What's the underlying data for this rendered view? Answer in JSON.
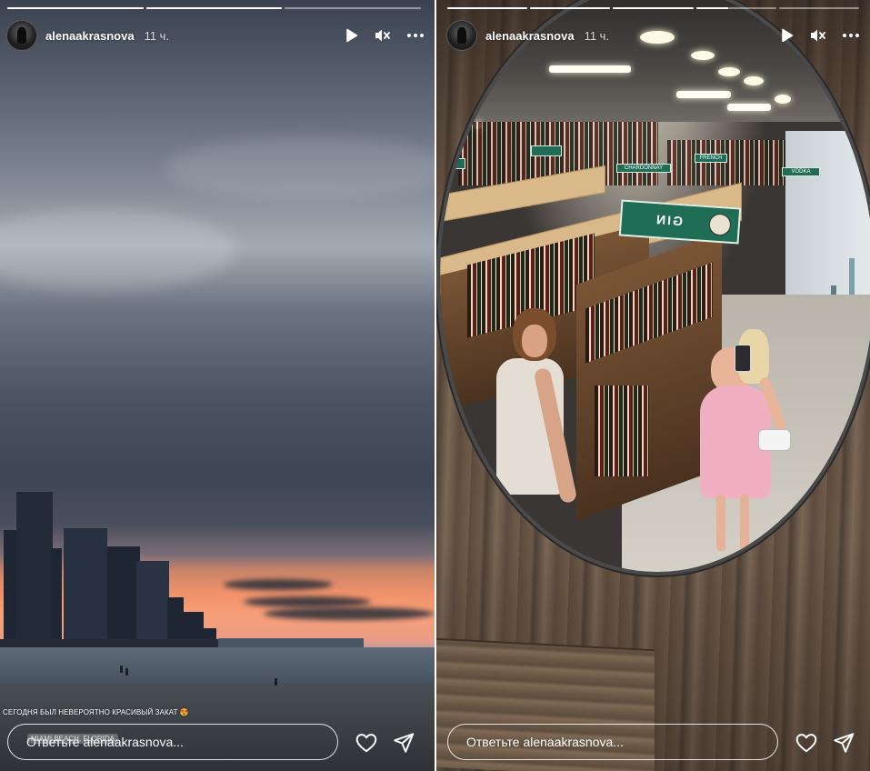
{
  "colors": {
    "overlay_text": "#ffffff",
    "progress_track": "rgba(255,255,255,0.45)",
    "progress_fill": "#ffffff",
    "gin_sign": "#1f6d55"
  },
  "stories": [
    {
      "progress": [
        1.0,
        1.0,
        0.0
      ],
      "username": "alenaakrasnova",
      "time": "11 ч.",
      "caption": "СЕГОДНЯ БЫЛ НЕВЕРОЯТНО КРАСИВЫЙ ЗАКАТ 😍",
      "location": "MIAMI BEACH, FLORIDA",
      "reply_placeholder": "Ответьте alenaakrasnova...",
      "icons": [
        "play-icon",
        "mute-icon",
        "more-icon",
        "heart-icon",
        "send-icon"
      ]
    },
    {
      "progress": [
        1.0,
        1.0,
        1.0,
        0.4,
        0.0
      ],
      "username": "alenaakrasnova",
      "time": "11 ч.",
      "reply_placeholder": "Ответьте alenaakrasnova...",
      "scene_signs": [
        "GIN",
        "CHARDONNAY",
        "FRENCH",
        "VODKA"
      ],
      "icons": [
        "play-icon",
        "mute-icon",
        "more-icon",
        "heart-icon",
        "send-icon"
      ]
    }
  ]
}
